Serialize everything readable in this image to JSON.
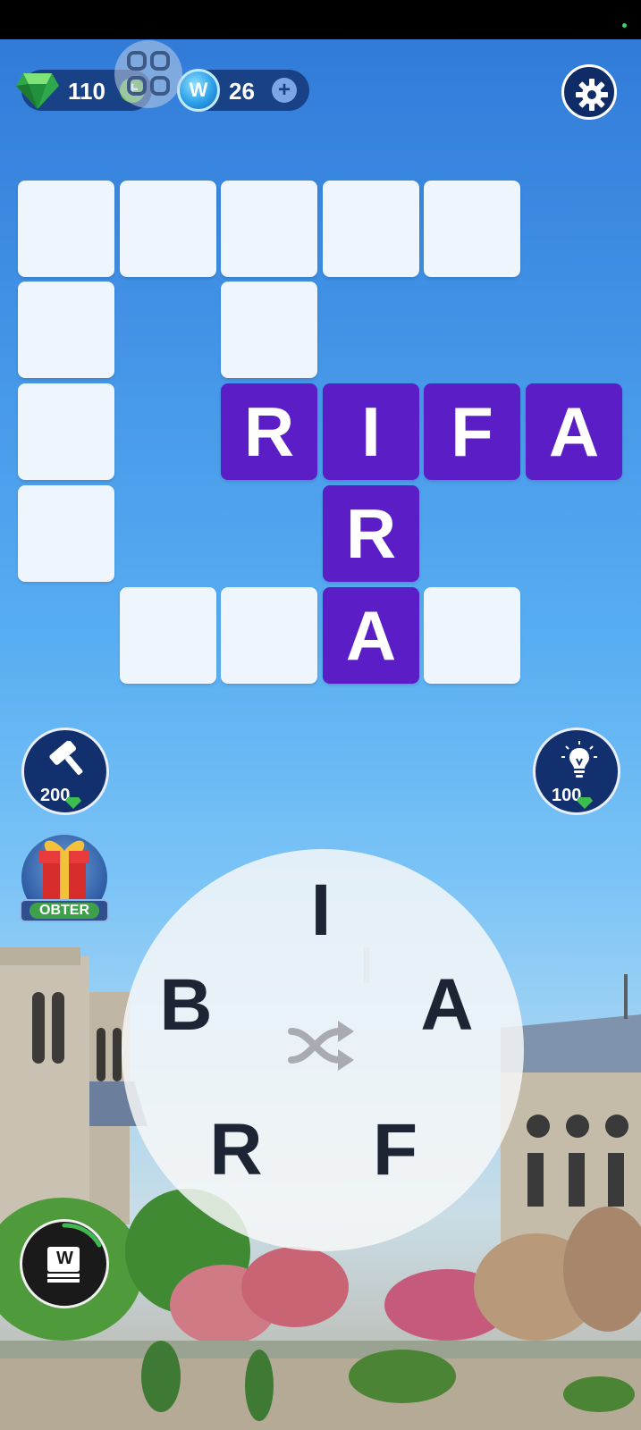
{
  "currency": {
    "gems": "110",
    "coins": "26",
    "plus_symbol": "+",
    "coin_symbol": "W"
  },
  "crossword": {
    "cells": [
      {
        "letter": ""
      },
      {
        "letter": ""
      },
      {
        "letter": ""
      },
      {
        "letter": ""
      },
      {
        "letter": ""
      },
      {
        "letter": ""
      },
      {
        "letter": ""
      },
      {
        "letter": ""
      },
      {
        "letter": "R"
      },
      {
        "letter": "I"
      },
      {
        "letter": "F"
      },
      {
        "letter": "A"
      },
      {
        "letter": ""
      },
      {
        "letter": "R"
      },
      {
        "letter": ""
      },
      {
        "letter": ""
      },
      {
        "letter": "A"
      },
      {
        "letter": ""
      }
    ],
    "solved_words": [
      "RIFA",
      "IRA"
    ],
    "filled_color": "#5b1ec6",
    "empty_color": "#eef5fd"
  },
  "powerups": {
    "hammer_cost": "200",
    "hint_cost": "100"
  },
  "gift": {
    "label": "OBTER"
  },
  "wheel": {
    "letters": [
      "I",
      "B",
      "A",
      "R",
      "F"
    ]
  },
  "daily": {
    "icon_letter": "W"
  }
}
